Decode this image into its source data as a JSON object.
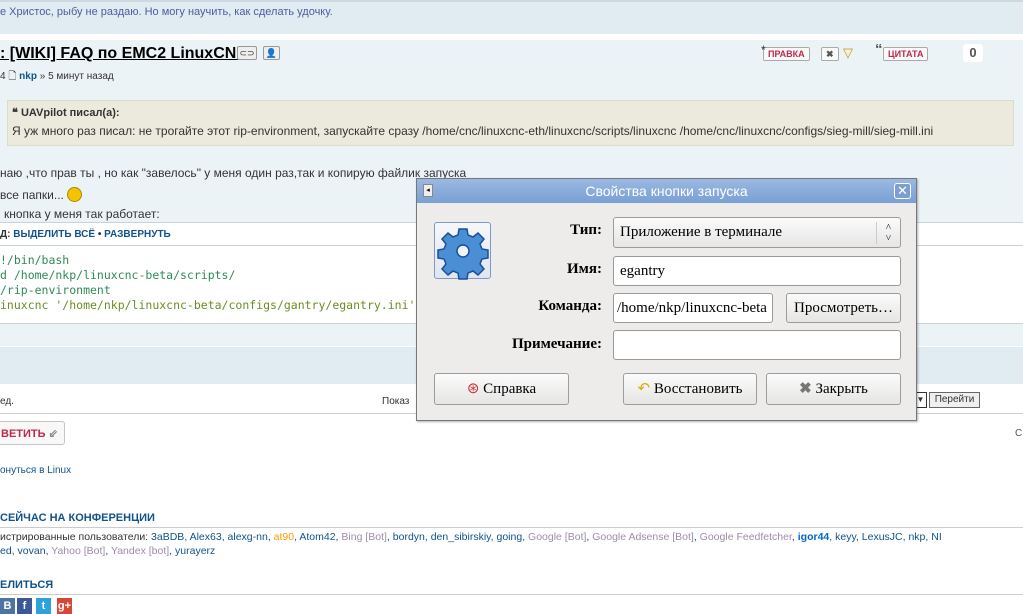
{
  "signature": "е Христос, рыбу не раздаю. Но могу научить, как сделать удочку.",
  "post": {
    "title": ": [WIKI] FAQ по EMC2 LinuxCNC",
    "meta_prefix": "4",
    "author": "nkp",
    "time": "» 5 минут назад",
    "buttons": {
      "edit": "ПРАВКА",
      "quote": "ЦИТАТА"
    },
    "score": "0",
    "quote_author": "UAVpilot писал(а):",
    "quote_text": "Я уж много раз писал: не трогайте этот rip-environment, запускайте сразу /home/cnc/linuxcnc-eth/linuxcnc/scripts/linuxcnc /home/cnc/linuxcnc/configs/sieg-mill/sieg-mill.ini",
    "lines": [
      "наю ,что прав ты , но как \"завелось\" у меня один раз,так и копирую файлик запуска",
      "все папки...",
      "кнопка у меня так работает:"
    ],
    "code_label": "Д:",
    "select_all": "ВЫДЕЛИТЬ ВСЁ",
    "expand": "РАЗВЕРНУТЬ",
    "code": [
      "!/bin/bash",
      "d  /home/nkp/linuxcnc-beta/scripts/",
      "/rip-environment",
      "inuxcnc '/home/nkp/linuxcnc-beta/configs/gantry/egantry.ini'"
    ]
  },
  "footer": {
    "left_text": "ед.",
    "show_text": "Показ",
    "go": "Перейти",
    "reply": "ВЕТИТЬ",
    "right_text": "С",
    "return_link": "онуться в Linux",
    "online_heading": "СЕЙЧАС НА КОНФЕРЕНЦИИ",
    "online_prefix": "истрированные пользователи:",
    "users_line1": [
      {
        "n": "3aBDB",
        "t": "u"
      },
      {
        "n": "Alex63",
        "t": "u"
      },
      {
        "n": "alexg-nn",
        "t": "u"
      },
      {
        "n": "at90",
        "t": "o"
      },
      {
        "n": "Atom42",
        "t": "u"
      },
      {
        "n": "Bing [Bot]",
        "t": "b"
      },
      {
        "n": "bordyn",
        "t": "u"
      },
      {
        "n": "den_sibirskiy",
        "t": "u"
      },
      {
        "n": "going",
        "t": "u"
      },
      {
        "n": "Google [Bot]",
        "t": "b"
      },
      {
        "n": "Google Adsense [Bot]",
        "t": "b"
      },
      {
        "n": "Google Feedfetcher",
        "t": "b"
      },
      {
        "n": "igor44",
        "t": "a"
      },
      {
        "n": "keyy",
        "t": "u"
      },
      {
        "n": "LexusJC",
        "t": "u"
      },
      {
        "n": "nkp",
        "t": "u"
      },
      {
        "n": "NI",
        "t": "u"
      }
    ],
    "users_line2": [
      {
        "n": "ed",
        "t": "u"
      },
      {
        "n": "vovan",
        "t": "u"
      },
      {
        "n": "Yahoo [Bot]",
        "t": "b"
      },
      {
        "n": "Yandex [bot]",
        "t": "b"
      },
      {
        "n": "yurayerz",
        "t": "u"
      }
    ],
    "share_heading": "ЕЛИТЬСЯ",
    "share": [
      {
        "label": "В",
        "color": "#4c75a3"
      },
      {
        "label": "f",
        "color": "#3b5998"
      },
      {
        "label": "t",
        "color": "#2ea2dd"
      },
      {
        "label": "g+",
        "color": "#d34836"
      }
    ]
  },
  "dialog": {
    "title": "Свойства кнопки запуска",
    "type_label": "Тип:",
    "type_value": "Приложение в терминале",
    "name_label": "Имя:",
    "name_value": "egantry",
    "command_label": "Команда:",
    "command_value": "/home/nkp/linuxcnc-beta",
    "browse": "Просмотреть…",
    "comment_label": "Примечание:",
    "comment_value": "",
    "help": "Справка",
    "revert": "Восстановить",
    "close": "Закрыть"
  }
}
